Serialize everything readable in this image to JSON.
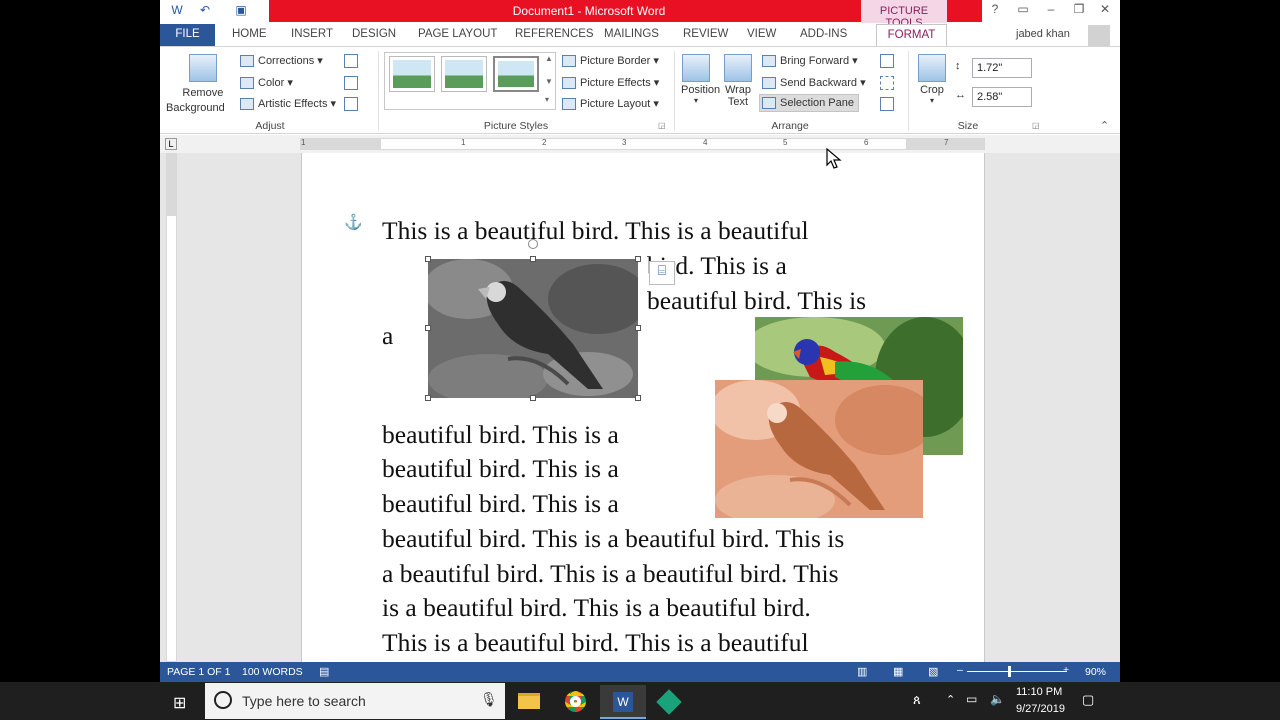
{
  "window": {
    "title": "Document1 - Microsoft Word",
    "context_tab": "PICTURE TOOLS",
    "user": "jabed khan"
  },
  "tabs": [
    "FILE",
    "HOME",
    "INSERT",
    "DESIGN",
    "PAGE LAYOUT",
    "REFERENCES",
    "MAILINGS",
    "REVIEW",
    "VIEW",
    "ADD-INS",
    "FORMAT"
  ],
  "ribbon": {
    "adjust": {
      "remove_bg_1": "Remove",
      "remove_bg_2": "Background",
      "corrections": "Corrections",
      "color": "Color",
      "artistic": "Artistic Effects",
      "label": "Adjust"
    },
    "styles": {
      "border": "Picture Border",
      "effects": "Picture Effects",
      "layout": "Picture Layout",
      "label": "Picture Styles"
    },
    "arrange": {
      "position": "Position",
      "wrap_1": "Wrap",
      "wrap_2": "Text",
      "bring_forward": "Bring Forward",
      "send_backward": "Send Backward",
      "selection_pane": "Selection Pane",
      "label": "Arrange"
    },
    "size": {
      "crop": "Crop",
      "height": "1.72\"",
      "width": "2.58\"",
      "label": "Size"
    }
  },
  "ruler_numbers": [
    "1",
    "1",
    "2",
    "3",
    "4",
    "5",
    "6",
    "7"
  ],
  "document": {
    "lines": [
      "This is a beautiful bird. This is a beautiful",
      "bird. This is a",
      "beautiful bird. This is",
      "a",
      "beautiful bird. This is a",
      "beautiful bird. This is a",
      "beautiful bird. This is a",
      "beautiful bird. This is a beautiful bird. This is",
      "a beautiful bird. This is a beautiful bird. This",
      "is a beautiful bird. This is a beautiful bird.",
      "This is a beautiful bird. This is a beautiful"
    ]
  },
  "status": {
    "page": "PAGE 1 OF 1",
    "words": "100 WORDS",
    "zoom": "90%"
  },
  "taskbar": {
    "search_placeholder": "Type here to search",
    "time": "11:10 PM",
    "date": "9/27/2019"
  },
  "colors": {
    "word_blue": "#2b579a",
    "title_red": "#e81123",
    "picture_tools_bg": "#f4d6e6",
    "picture_tools_text": "#8b1f5f"
  }
}
